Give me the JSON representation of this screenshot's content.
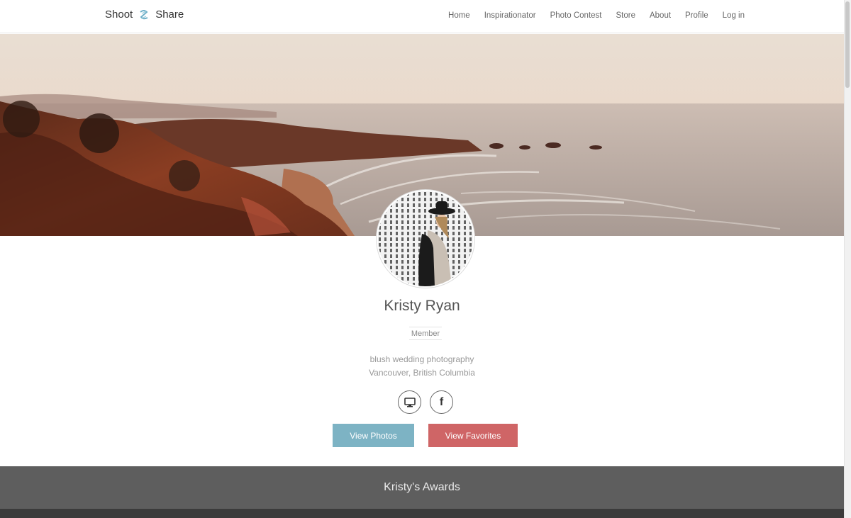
{
  "header": {
    "logo_left": "Shoot",
    "logo_right": "Share",
    "nav": [
      "Home",
      "Inspirationator",
      "Photo Contest",
      "Store",
      "About",
      "Profile",
      "Log in"
    ]
  },
  "profile": {
    "name": "Kristy Ryan",
    "badge": "Member",
    "bio_line1": "blush wedding photography",
    "bio_line2": "Vancouver, British Columbia",
    "facebook_glyph": "f",
    "view_photos": "View Photos",
    "view_favorites": "View Favorites"
  },
  "awards": {
    "title": "Kristy's Awards"
  },
  "colors": {
    "view_photos_bg": "#7db3c4",
    "view_favorites_bg": "#cf6566",
    "awards_bg": "#5e5e5e"
  }
}
